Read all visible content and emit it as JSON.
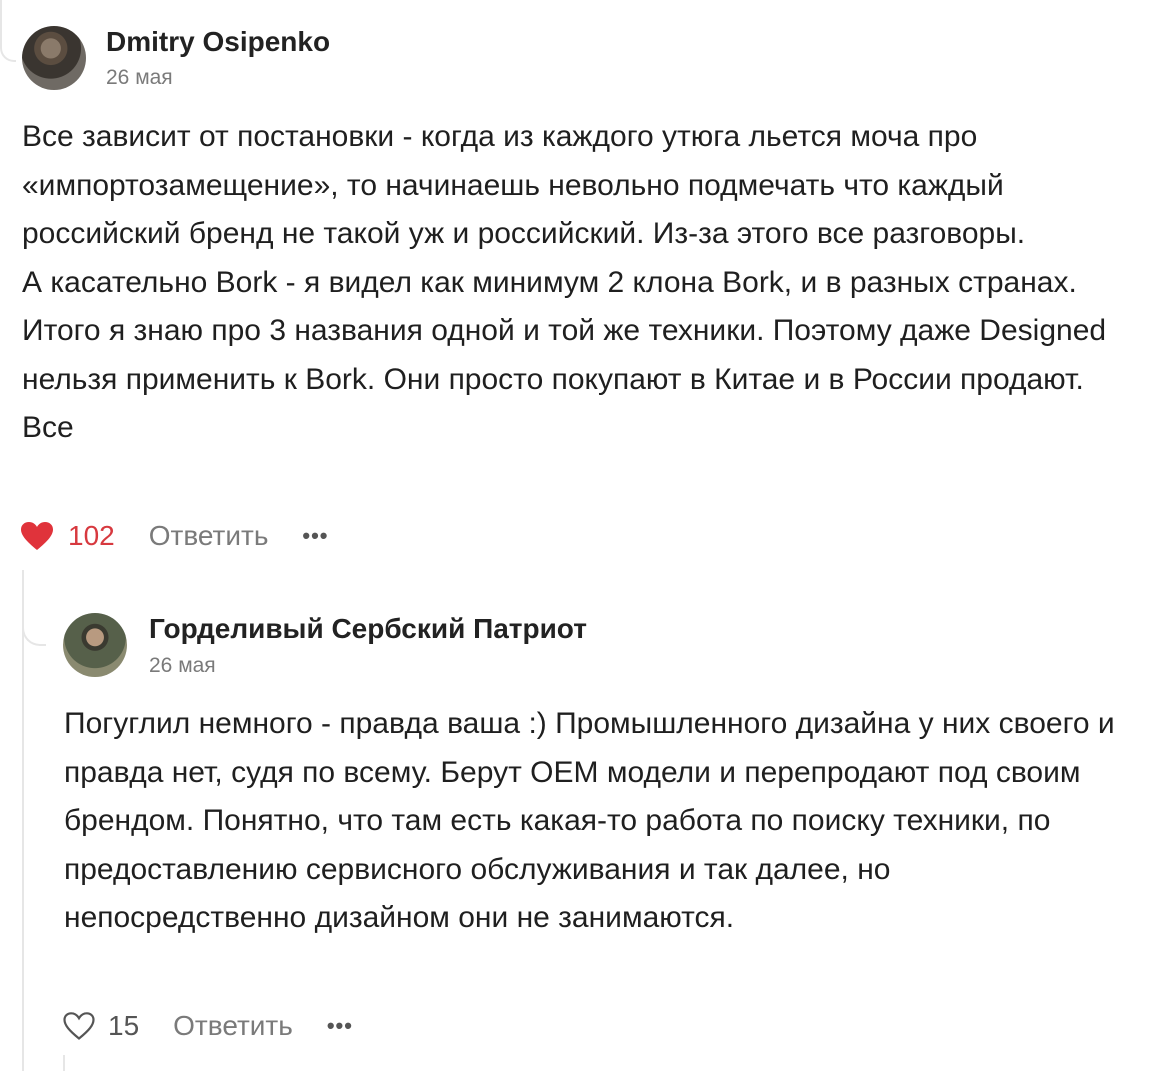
{
  "comments": [
    {
      "author": "Dmitry Osipenko",
      "date": "26 мая",
      "paragraphs": [
        "Все зависит от постановки - когда из каждого утюга льется моча про «импортозамещение», то начинаешь невольно подмечать что каждый российский бренд не такой уж и российский. Из-за этого все разговоры.",
        "А касательно Bork - я видел как минимум 2 клона Bork, и в разных странах. Итого я знаю про 3 названия одной и той же техники. Поэтому даже Designed нельзя применить к Bork. Они просто покупают в Китае и в России продают. Все"
      ],
      "likes": "102",
      "liked": true,
      "reply_label": "Ответить",
      "more_label": "•••"
    },
    {
      "author": "Горделивый Сербский Патриот",
      "date": "26 мая",
      "paragraphs": [
        "Погуглил немного - правда ваша :) Промышленного дизайна у них своего и правда нет, судя по всему. Берут OEM модели и перепродают под своим брендом. Понятно, что там есть какая-то работа по поиску техники, по предоставлению сервисного обслуживания и так далее, но непосредственно дизайном они не занимаются."
      ],
      "likes": "15",
      "liked": false,
      "reply_label": "Ответить",
      "more_label": "•••"
    }
  ],
  "colors": {
    "liked_heart": "#d7393f",
    "muted_text": "#7a7a7a",
    "thread_line": "#e6e6e6"
  }
}
